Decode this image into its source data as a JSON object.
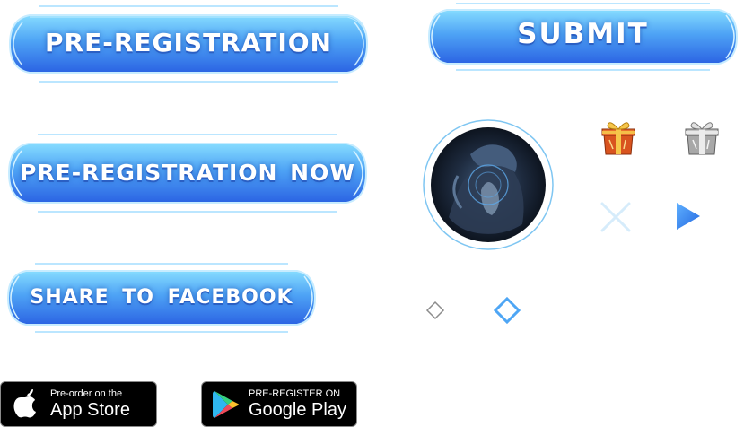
{
  "buttons": {
    "pre_registration": "PRE-REGISTRATION",
    "submit": "SUBMIT",
    "pre_registration_now": "PRE-REGISTRATION NOW",
    "share_to_facebook": "SHARE TO FACEBOOK"
  },
  "icons": {
    "gift_gold": "gift-box-gold",
    "gift_silver": "gift-box-silver",
    "close": "close-x",
    "play": "play-triangle",
    "diamond_small": "diamond-outline-gray",
    "diamond_large": "diamond-outline-blue"
  },
  "app_store": {
    "small_text": "Pre-order on the",
    "big_text": "App Store"
  },
  "google_play": {
    "small_text": "PRE-REGISTER ON",
    "big_text": "Google Play"
  },
  "colors": {
    "button_top": "#7ad3ff",
    "button_bottom": "#2f6ee8",
    "button_border": "#bfe9ff",
    "accent_blue": "#3a86f0"
  }
}
